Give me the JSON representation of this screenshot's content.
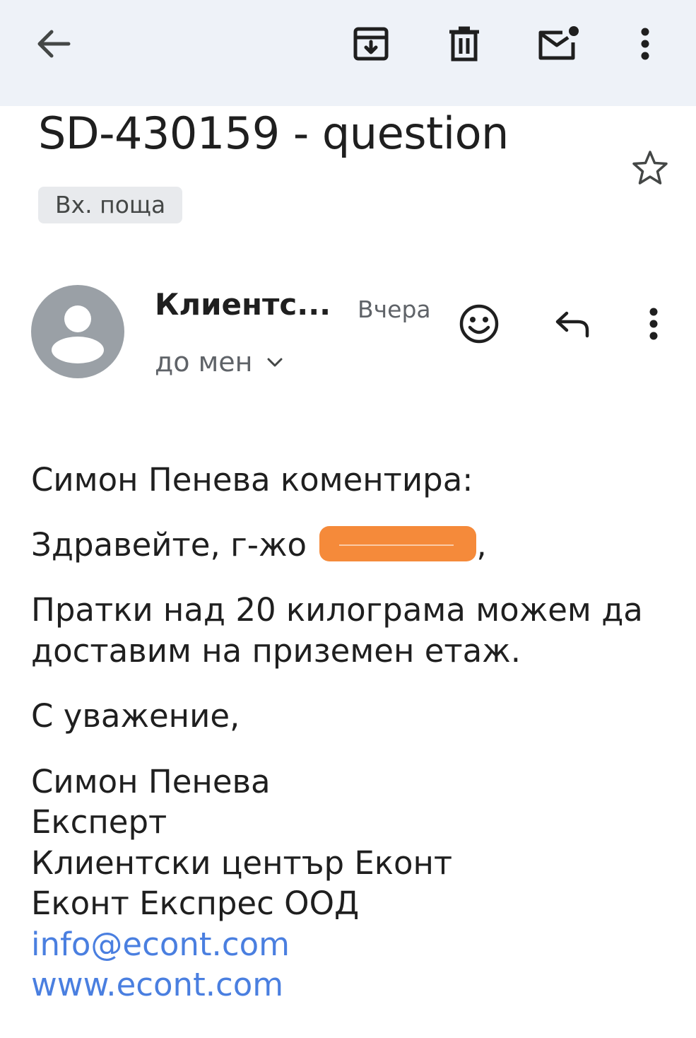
{
  "toolbar": {
    "back_icon": "arrow-back-icon",
    "archive_icon": "archive-icon",
    "delete_icon": "trash-icon",
    "mark_unread_icon": "mark-unread-icon",
    "more_icon": "more-vert-icon"
  },
  "email": {
    "subject": "SD-430159 - question",
    "label": "Вх. поща",
    "sender": "Клиентс...",
    "date": "Вчера",
    "recipient": "до мен",
    "body": {
      "line1": "Симон Пенева коментира:",
      "greeting_prefix": "Здравейте, г-жо",
      "greeting_suffix": ",",
      "para1_line1": "Пратки над 20 килограма можем да",
      "para1_line2": "доставим на приземен етаж.",
      "closing": "С уважение,",
      "sig_name": "Симон Пенева",
      "sig_title": "Експерт",
      "sig_dept": "Клиентски център Еконт",
      "sig_company": "Еконт Експрес ООД",
      "sig_email": "info@econt.com",
      "sig_web": "www.econt.com"
    }
  },
  "colors": {
    "topbar_bg": "#eef2f8",
    "avatar": "#9aa0a6",
    "link": "#4a7fe0",
    "redaction": "#f58a3a"
  }
}
